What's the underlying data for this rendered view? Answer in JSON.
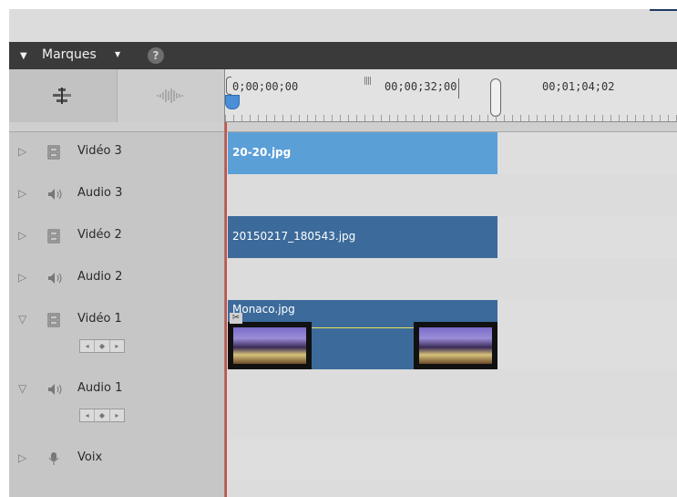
{
  "markers_panel": {
    "toggle_icon": "triangle-down",
    "label": "Marques",
    "dropdown_icon": "caret-down",
    "help_icon": "?"
  },
  "view_modes": {
    "timeline_icon": "timeline-view-icon",
    "audio_icon": "waveform-icon"
  },
  "ruler": {
    "timecodes": [
      "0;00;00;00",
      "00;00;32;00",
      "00;01;04;02"
    ]
  },
  "colors": {
    "selected_clip": "#5b9fd7",
    "clip": "#3c6b9b",
    "playhead": "#d84a3a",
    "track_header": "#c6c6c6"
  },
  "tracks": [
    {
      "name": "Vidéo 3",
      "type": "video",
      "expanded": false,
      "icon": "film-icon"
    },
    {
      "name": "Audio 3",
      "type": "audio",
      "expanded": false,
      "icon": "speaker-icon"
    },
    {
      "name": "Vidéo 2",
      "type": "video",
      "expanded": false,
      "icon": "film-icon"
    },
    {
      "name": "Audio 2",
      "type": "audio",
      "expanded": false,
      "icon": "speaker-icon"
    },
    {
      "name": "Vidéo 1",
      "type": "video",
      "expanded": true,
      "icon": "film-icon"
    },
    {
      "name": "Audio 1",
      "type": "audio",
      "expanded": true,
      "icon": "speaker-icon"
    },
    {
      "name": "Voix",
      "type": "voice",
      "expanded": false,
      "icon": "microphone-icon"
    }
  ],
  "keyframe_nav": [
    "◂",
    "◆",
    "▸"
  ],
  "clips": {
    "video3": "20-20.jpg",
    "video2": "20150217_180543.jpg",
    "video1": "Monaco.jpg"
  }
}
